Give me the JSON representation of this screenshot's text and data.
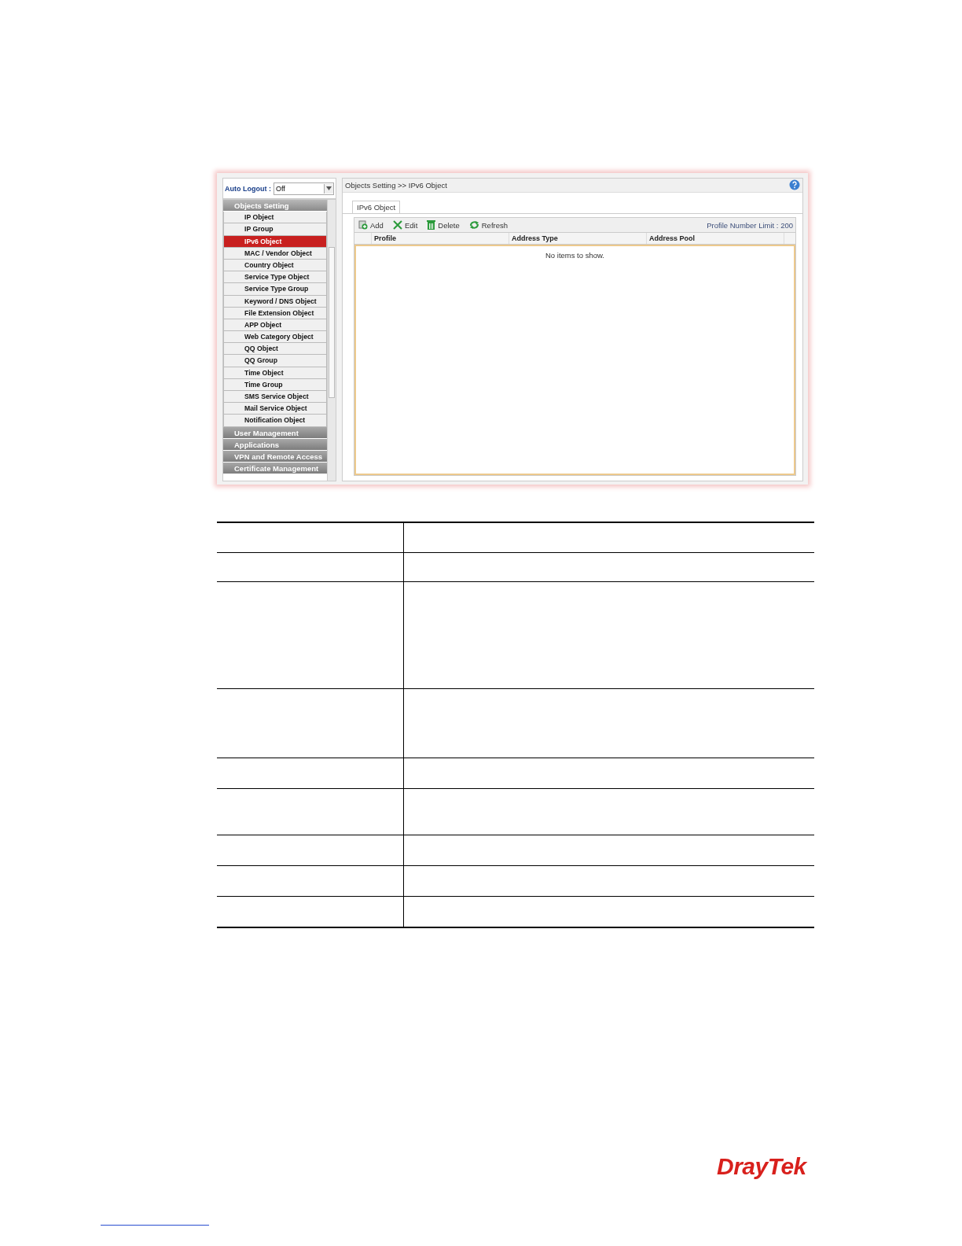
{
  "sidebar": {
    "auto_logout": {
      "label": "Auto Logout :",
      "value": "Off"
    },
    "groups": [
      {
        "label": "Objects Setting",
        "expanded": true,
        "items": [
          {
            "label": "IP Object",
            "selected": false
          },
          {
            "label": "IP Group",
            "selected": false
          },
          {
            "label": "IPv6 Object",
            "selected": true
          },
          {
            "label": "MAC / Vendor Object",
            "selected": false
          },
          {
            "label": "Country Object",
            "selected": false
          },
          {
            "label": "Service Type Object",
            "selected": false
          },
          {
            "label": "Service Type Group",
            "selected": false
          },
          {
            "label": "Keyword / DNS Object",
            "selected": false
          },
          {
            "label": "File Extension Object",
            "selected": false
          },
          {
            "label": "APP Object",
            "selected": false
          },
          {
            "label": "Web Category Object",
            "selected": false
          },
          {
            "label": "QQ Object",
            "selected": false
          },
          {
            "label": "QQ Group",
            "selected": false
          },
          {
            "label": "Time Object",
            "selected": false
          },
          {
            "label": "Time Group",
            "selected": false
          },
          {
            "label": "SMS Service Object",
            "selected": false
          },
          {
            "label": "Mail Service Object",
            "selected": false
          },
          {
            "label": "Notification Object",
            "selected": false
          }
        ]
      },
      {
        "label": "User Management",
        "expanded": false
      },
      {
        "label": "Applications",
        "expanded": false
      },
      {
        "label": "VPN and Remote Access",
        "expanded": false
      },
      {
        "label": "Certificate Management",
        "expanded": false
      }
    ]
  },
  "main": {
    "breadcrumb": "Objects Setting >> IPv6 Object",
    "tabs": [
      {
        "label": "IPv6 Object",
        "selected": true
      }
    ],
    "toolbar": [
      {
        "kind": "add",
        "label": "Add"
      },
      {
        "kind": "edit",
        "label": "Edit"
      },
      {
        "kind": "delete",
        "label": "Delete"
      },
      {
        "kind": "refresh",
        "label": "Refresh"
      }
    ],
    "limit": "Profile Number Limit : 200",
    "table": {
      "columns": [
        "Profile",
        "Address Type",
        "Address Pool"
      ],
      "empty_text": "No items to show."
    }
  },
  "logo": "DrayTek"
}
